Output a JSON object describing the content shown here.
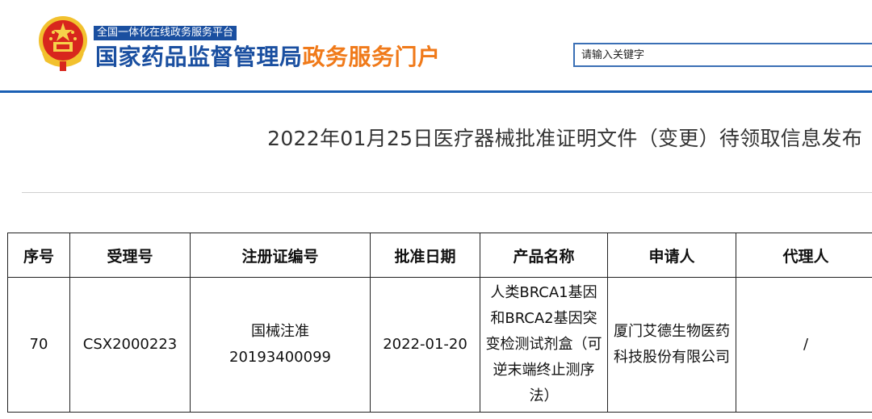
{
  "header": {
    "emblem": "national-emblem-icon",
    "platform_tag": "全国一体化在线政务服务平台",
    "title_part1": "国家药品监督管理局",
    "title_part2": "政务服务门户",
    "search_placeholder": "请输入关键字"
  },
  "page": {
    "heading": "2022年01月25日医疗器械批准证明文件（变更）待领取信息发布"
  },
  "table": {
    "headers": [
      "序号",
      "受理号",
      "注册证编号",
      "批准日期",
      "产品名称",
      "申请人",
      "代理人"
    ],
    "rows": [
      {
        "seq": "70",
        "acceptance_no": "CSX2000223",
        "reg_no_line1": "国械注准",
        "reg_no_line2": "20193400099",
        "approval_date": "2022-01-20",
        "product_name": "人类BRCA1基因和BRCA2基因突变检测试剂盒（可逆末端终止测序法）",
        "applicant": "厦门艾德生物医药科技股份有限公司",
        "agent": "/"
      }
    ]
  },
  "colors": {
    "brand_blue": "#1a4fa0",
    "brand_orange": "#f07a1a",
    "header_line": "#1a5fb4"
  }
}
